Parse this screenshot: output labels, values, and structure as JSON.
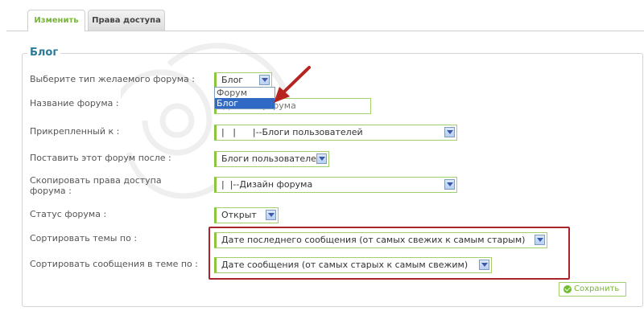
{
  "tabs": [
    {
      "label": "Изменить"
    },
    {
      "label": "Права доступа"
    }
  ],
  "section_title": "Блог",
  "fields": {
    "forum_type": {
      "label": "Выберите тип желаемого форума :",
      "value": "Блог",
      "options": [
        "Форум",
        "Блог"
      ]
    },
    "forum_name": {
      "label": "Название форума :",
      "value": "Дизайн форума"
    },
    "attached_to": {
      "label": "Прикрепленный к :",
      "value": "|   |      |--Блоги пользователей"
    },
    "place_after": {
      "label": "Поставить этот форум после :",
      "value": "Блоги пользователей"
    },
    "copy_rights": {
      "label": "Скопировать права доступа форума  :",
      "value": "|  |--Дизайн форума"
    },
    "forum_status": {
      "label": "Статус форума :",
      "value": "Открыт"
    },
    "sort_topics": {
      "label": "Сортировать темы по :",
      "value": "Дате последнего сообщения (от самых свежих к самым старым)"
    },
    "sort_posts": {
      "label": "Сортировать сообщения в теме по :",
      "value": "Дате сообщения (от самых старых к самым свежим)"
    }
  },
  "save_label": "Сохранить",
  "colors": {
    "accent": "#8cc63f",
    "title": "#2b7a97",
    "highlight": "#a8262b",
    "selection": "#316ac5"
  }
}
